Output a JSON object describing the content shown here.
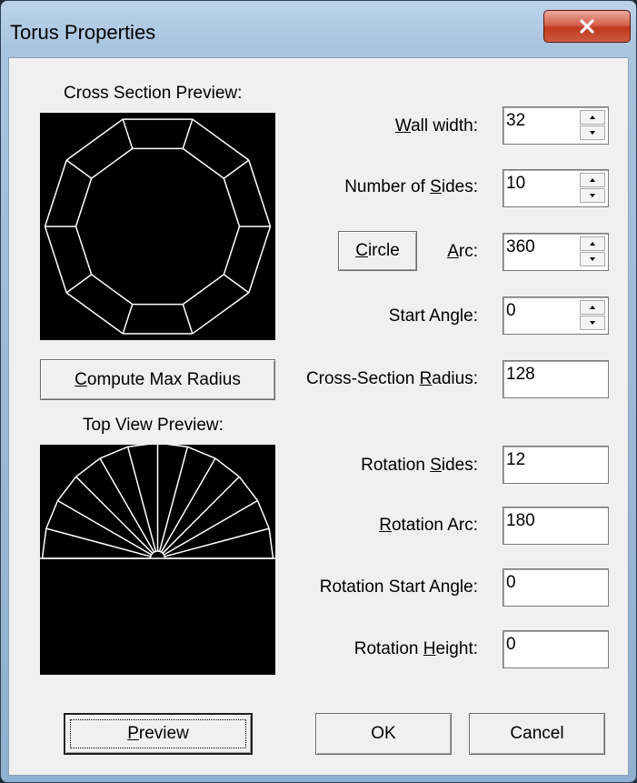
{
  "window": {
    "title": "Torus Properties",
    "close_icon": "close-icon"
  },
  "left": {
    "cross_section_label": "Cross Section Preview:",
    "compute_button": {
      "mnemonic": "C",
      "rest": "ompute Max Radius"
    },
    "top_view_label": "Top View Preview:"
  },
  "fields": {
    "wall_width": {
      "pre": "",
      "mnemonic": "W",
      "post": "all width:",
      "value": "32"
    },
    "number_of_sides": {
      "pre": "Number of ",
      "mnemonic": "S",
      "post": "ides:",
      "value": "10"
    },
    "circle_button": {
      "mnemonic": "C",
      "rest": "ircle"
    },
    "arc": {
      "pre": "",
      "mnemonic": "A",
      "post": "rc:",
      "value": "360"
    },
    "start_angle": {
      "label": "Start Angle:",
      "value": "0"
    },
    "cross_section_radius": {
      "pre": "Cross-Section ",
      "mnemonic": "R",
      "post": "adius:",
      "value": "128"
    },
    "rotation_sides": {
      "pre": "Rotation ",
      "mnemonic": "S",
      "post": "ides:",
      "value": "12"
    },
    "rotation_arc": {
      "pre": "",
      "mnemonic": "R",
      "post": "otation Arc:",
      "value": "180"
    },
    "rotation_start_angle": {
      "label": "Rotation Start Angle:",
      "value": "0"
    },
    "rotation_height": {
      "pre": "Rotation ",
      "mnemonic": "H",
      "post": "eight:",
      "value": "0"
    }
  },
  "buttons": {
    "preview": {
      "mnemonic": "P",
      "rest": "review"
    },
    "ok": "OK",
    "cancel": "Cancel"
  },
  "preview": {
    "cross_section_sides": 10,
    "rotation_sides": 12,
    "rotation_arc": 180
  },
  "colors": {
    "preview_background": "#000000",
    "preview_lines": "#ffffff",
    "close_button": "#c7452d"
  }
}
